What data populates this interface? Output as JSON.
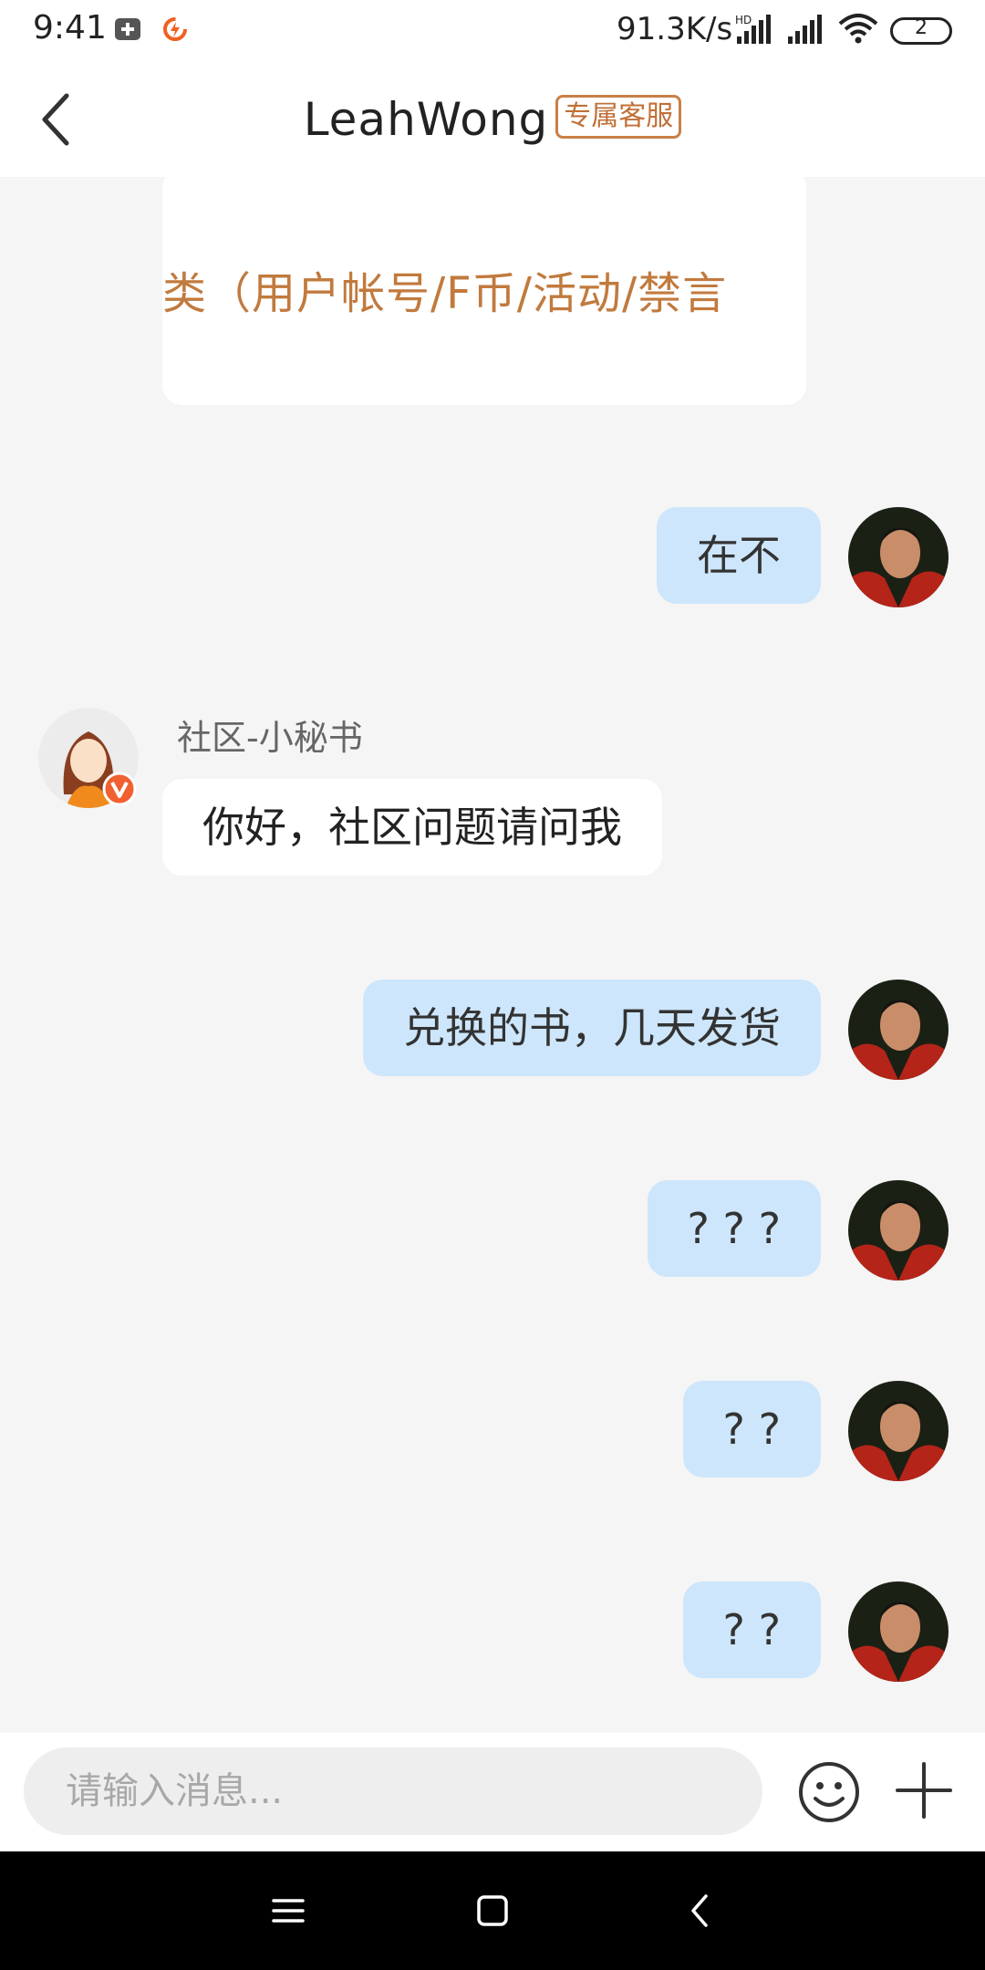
{
  "status_bar": {
    "time": "9:41",
    "speed": "91.3K/s",
    "battery": "2",
    "icons": [
      "plus-box-icon",
      "flash-app-icon",
      "hd-signal-icon",
      "signal-icon",
      "wifi-icon",
      "battery-icon"
    ]
  },
  "header": {
    "title": "LeahWong",
    "badge": "专属客服"
  },
  "messages": {
    "partial_card_text": "类（用户帐号/F币/活动/禁言",
    "m1": "在不",
    "sender_name": "社区-小秘书",
    "m2": "你好，社区问题请问我",
    "m3": "兑换的书，几天发货",
    "m4": "? ? ?",
    "m5": "? ?",
    "m6": "? ?"
  },
  "input": {
    "placeholder": "请输入消息..."
  },
  "colors": {
    "bubble_me": "#cde6fb",
    "bubble_other": "#ffffff",
    "accent_orange": "#c17a3e",
    "background": "#f5f5f5"
  }
}
